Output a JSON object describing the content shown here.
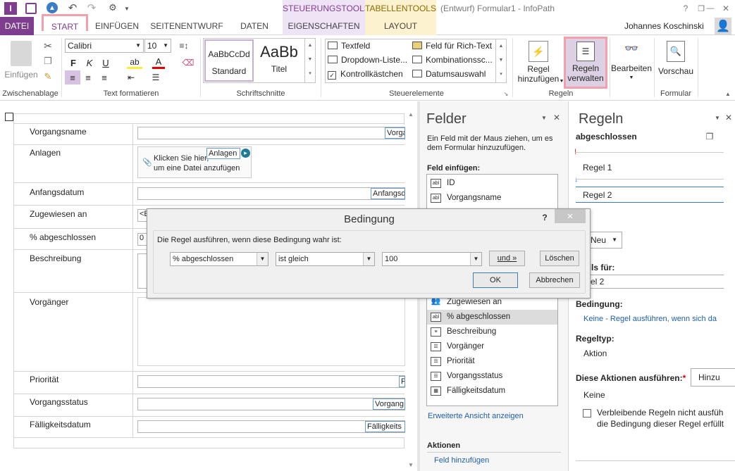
{
  "titlebar": {
    "context1": "STEUERUNGSTOOLS",
    "context2": "TABELLENTOOLS",
    "doc_title": "(Entwurf) Formular1 - InfoPath",
    "help": "?",
    "minimize": "—",
    "restore": "❐",
    "close": "✕"
  },
  "tabs": {
    "datei": "DATEI",
    "start": "START",
    "einfuegen": "EINFÜGEN",
    "seitenentwurf": "SEITENENTWURF",
    "daten": "DATEN",
    "eigenschaften": "EIGENSCHAFTEN",
    "layout": "LAYOUT",
    "user": "Johannes Koschinski"
  },
  "ribbon": {
    "clipboard": {
      "paste": "Einfügen",
      "label": "Zwischenablage"
    },
    "font": {
      "name": "Calibri",
      "size": "10",
      "bold": "F",
      "italic": "K",
      "underline": "U",
      "label": "Text formatieren"
    },
    "styles": {
      "style1_preview": "AaBbCcDd",
      "style1_name": "Standard",
      "style2_preview": "AaBb",
      "style2_name": "Titel",
      "label": "Schriftschnitte"
    },
    "controls": {
      "c1": "Textfeld",
      "c2": "Dropdown-Liste...",
      "c3": "Kontrollkästchen",
      "c4": "Feld für Rich-Text",
      "c5": "Kombinationssc...",
      "c6": "Datumsauswahl",
      "label": "Steuerelemente"
    },
    "rules": {
      "add_line1": "Regel",
      "add_line2": "hinzufügen",
      "manage_line1": "Regeln",
      "manage_line2": "verwalten",
      "label": "Regeln"
    },
    "edit": {
      "label_btn": "Bearbeiten"
    },
    "form": {
      "preview": "Vorschau",
      "label": "Formular"
    }
  },
  "form": {
    "rows": [
      {
        "label": "Vorgangsname",
        "tag": "Vorga"
      },
      {
        "label": "Anlagen",
        "attach1": "Klicken Sie hier,",
        "attach2": "um eine Datei anzufügen",
        "tag": "Anlagen"
      },
      {
        "label": "Anfangsdatum",
        "tag": "Anfangsd"
      },
      {
        "label": "Zugewiesen an",
        "value": "<E"
      },
      {
        "label": "% abgeschlossen",
        "value": "0"
      },
      {
        "label": "Beschreibung"
      },
      {
        "label": "Vorgänger"
      },
      {
        "label": "Priorität",
        "tag": "P"
      },
      {
        "label": "Vorgangsstatus",
        "tag": "Vorgang"
      },
      {
        "label": "Fälligkeitsdatum",
        "tag": "Fälligkeits"
      }
    ]
  },
  "felder": {
    "title": "Felder",
    "intro": "Ein Feld mit der Maus ziehen, um es dem Formular hinzuzufügen.",
    "insert_label": "Feld einfügen:",
    "items_top": [
      "ID",
      "Vorgangsname"
    ],
    "items_bottom": [
      "Zugewiesen an",
      "% abgeschlossen",
      "Beschreibung",
      "Vorgänger",
      "Priorität",
      "Vorgangsstatus",
      "Fälligkeitsdatum"
    ],
    "advanced": "Erweiterte Ansicht anzeigen",
    "actions": "Aktionen",
    "add_field": "Feld hinzufügen"
  },
  "regeln": {
    "title": "Regeln",
    "subject": "abgeschlossen",
    "rule1": "Regel 1",
    "rule2": "Regel 2",
    "new_btn": "Neu",
    "details_for": "ails für:",
    "details_value": "el 2",
    "condition_label": "Bedingung:",
    "condition_value": "Keine - Regel ausführen, wenn sich da",
    "ruletype_label": "Regeltyp:",
    "ruletype_value": "Aktion",
    "actions_label": "Diese Aktionen ausführen:",
    "actions_required": "*",
    "add_btn": "Hinzu",
    "actions_value": "Keine",
    "checkbox_text1": "Verbleibende Regeln nicht ausfüh",
    "checkbox_text2": "die Bedingung dieser Regel erfüllt"
  },
  "dialog": {
    "title": "Bedingung",
    "help": "?",
    "close": "✕",
    "prompt": "Die Regel ausführen, wenn diese Bedingung wahr ist:",
    "field": "% abgeschlossen",
    "operator": "ist gleich",
    "value": "100",
    "and_btn": "und »",
    "delete_btn": "Löschen",
    "ok_btn": "OK",
    "cancel_btn": "Abbrechen"
  },
  "colors": {
    "accent": "#7e3d8f",
    "highlight": "#f2a0aa",
    "context_bg": "#efe4f6",
    "tabletools_bg": "#fdf2cf"
  }
}
